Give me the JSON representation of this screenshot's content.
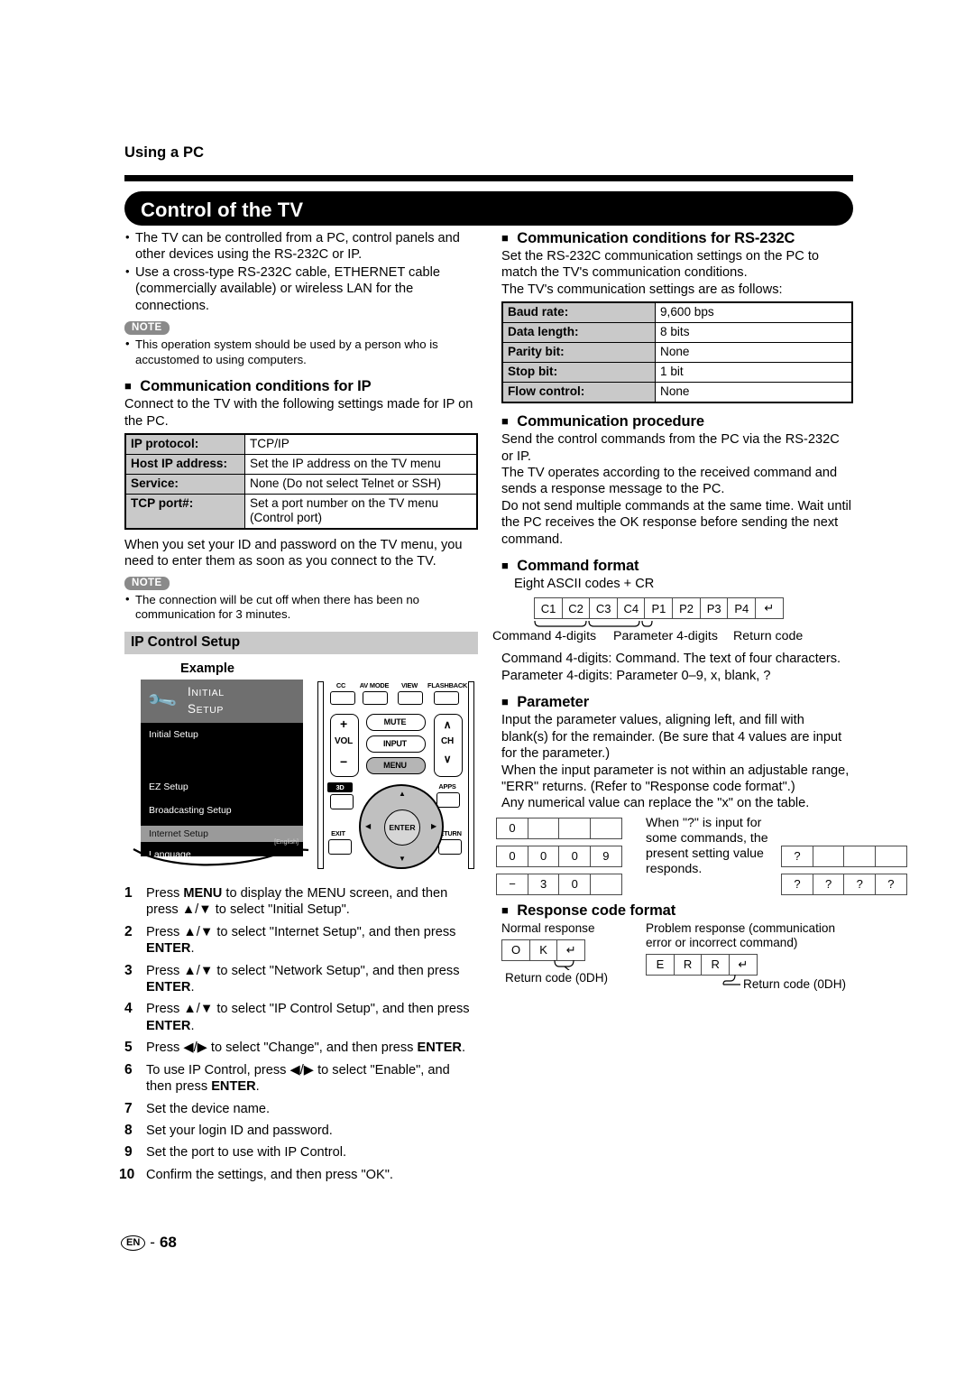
{
  "header": {
    "running_head": "Using a PC",
    "title": "Control of the TV"
  },
  "left": {
    "intro_bullets": [
      "The TV can be controlled from a PC, control panels and other devices using the RS-232C or IP.",
      "Use a cross-type RS-232C cable, ETHERNET cable (commercially available) or wireless LAN for the connections."
    ],
    "note1_label": "NOTE",
    "note1_items": [
      "This operation system should be used by a person who is accustomed to using computers."
    ],
    "ip_section": {
      "heading": "Communication conditions for IP",
      "intro": "Connect to the TV with the following settings made for IP on the PC.",
      "rows": [
        {
          "key": "IP protocol:",
          "value": "TCP/IP"
        },
        {
          "key": "Host IP address:",
          "value": "Set the IP address on the TV menu"
        },
        {
          "key": "Service:",
          "value": "None (Do not select Telnet or SSH)"
        },
        {
          "key": "TCP port#:",
          "value": "Set a port number on the TV menu (Control port)"
        }
      ],
      "after_table": "When you set your ID and password on the TV menu, you need to enter them as soon as you connect to the TV."
    },
    "note2_label": "NOTE",
    "note2_items": [
      "The connection will be cut off when there has been no communication for 3 minutes."
    ],
    "ip_control_setup": {
      "bar_label": "IP Control Setup",
      "example_label": "Example",
      "tv_menu": {
        "title_line1": "INITIAL",
        "title_line2": "SETUP",
        "icon": "wrench-icon",
        "items": [
          {
            "label": "Initial Setup",
            "selected": false
          },
          {
            "label": "EZ Setup",
            "selected": false
          },
          {
            "label": "Broadcasting Setup",
            "selected": false
          },
          {
            "label": "Internet Setup",
            "selected": true
          },
          {
            "label": "Language",
            "selected": false
          }
        ],
        "language_tag": "[English]"
      },
      "remote": {
        "top_row": [
          "CC",
          "AV MODE",
          "VIEW MODE",
          "FLASHBACK"
        ],
        "vol_plus": "+",
        "vol_label": "VOL",
        "vol_minus": "−",
        "mute": "MUTE",
        "input": "INPUT",
        "menu": "MENU",
        "ch_up": "∧",
        "ch_label": "CH",
        "ch_down": "∨",
        "three_d": "3D",
        "apps": "APPS",
        "exit": "EXIT",
        "return": "RETURN",
        "enter": "ENTER"
      }
    },
    "steps": [
      {
        "n": "1",
        "html": "Press <b>MENU</b> to display the MENU screen, and then press ▲/▼ to select \"Initial Setup\"."
      },
      {
        "n": "2",
        "html": "Press ▲/▼ to select \"Internet Setup\", and then press <b>ENTER</b>."
      },
      {
        "n": "3",
        "html": "Press ▲/▼ to select \"Network Setup\", and then press <b>ENTER</b>."
      },
      {
        "n": "4",
        "html": "Press ▲/▼ to select \"IP Control Setup\", and then press <b>ENTER</b>."
      },
      {
        "n": "5",
        "html": "Press ◀/▶ to select \"Change\", and then press <b>ENTER</b>."
      },
      {
        "n": "6",
        "html": "To use IP Control, press ◀/▶ to select \"Enable\", and then press <b>ENTER</b>."
      },
      {
        "n": "7",
        "html": "Set the device name."
      },
      {
        "n": "8",
        "html": "Set your login ID and password."
      },
      {
        "n": "9",
        "html": "Set the port to use with IP Control."
      },
      {
        "n": "10",
        "html": "Confirm the settings, and then press \"OK\"."
      }
    ]
  },
  "right": {
    "rs232c": {
      "heading": "Communication conditions for RS-232C",
      "intro": "Set the RS-232C communication settings on the PC to match the TV's communication conditions.\nThe TV's communication settings are as follows:",
      "rows": [
        {
          "key": "Baud rate:",
          "value": "9,600 bps"
        },
        {
          "key": "Data length:",
          "value": "8 bits"
        },
        {
          "key": "Parity bit:",
          "value": "None"
        },
        {
          "key": "Stop bit:",
          "value": "1 bit"
        },
        {
          "key": "Flow control:",
          "value": "None"
        }
      ]
    },
    "procedure": {
      "heading": "Communication procedure",
      "body": "Send the control commands from the PC via the RS-232C or IP.\nThe TV operates according to the received command and sends a response message to the PC.\nDo not send multiple commands at the same time. Wait until the PC receives the OK response before sending the next command."
    },
    "command_format": {
      "heading": "Command format",
      "lead": "Eight ASCII codes + CR",
      "cells": [
        "C1",
        "C2",
        "C3",
        "C4",
        "P1",
        "P2",
        "P3",
        "P4",
        "↵"
      ],
      "brace_labels": [
        "Command 4-digits",
        "Parameter 4-digits",
        "Return code"
      ],
      "notes": [
        "Command 4-digits: Command. The text of four characters.",
        "Parameter 4-digits: Parameter 0–9, x, blank, ?"
      ]
    },
    "parameter": {
      "heading": "Parameter",
      "body": "Input the parameter values, aligning left, and fill with blank(s) for the remainder. (Be sure that 4 values are input for the parameter.)\nWhen the input parameter is not within an adjustable range, \"ERR\" returns. (Refer to \"Response code format\".)\nAny numerical value can replace the \"x\" on the table.",
      "examples": [
        [
          "0",
          "",
          "",
          ""
        ],
        [
          "0",
          "0",
          "0",
          "9"
        ],
        [
          "−",
          "3",
          "0",
          ""
        ]
      ],
      "question_note": "When \"?\" is input for some commands, the present setting value responds.",
      "question_examples": [
        [
          "?",
          "",
          "",
          ""
        ],
        [
          "?",
          "?",
          "?",
          "?"
        ]
      ]
    },
    "response": {
      "heading": "Response code format",
      "normal_label": "Normal response",
      "normal_cells": [
        "O",
        "K",
        "↵"
      ],
      "normal_caption": "Return code (0DH)",
      "problem_label": "Problem response (communication error or incorrect command)",
      "problem_cells": [
        "E",
        "R",
        "R",
        "↵"
      ],
      "problem_caption": "Return code (0DH)"
    }
  },
  "footer": {
    "lang_code": "EN",
    "dash": "-",
    "page_number": "68"
  }
}
